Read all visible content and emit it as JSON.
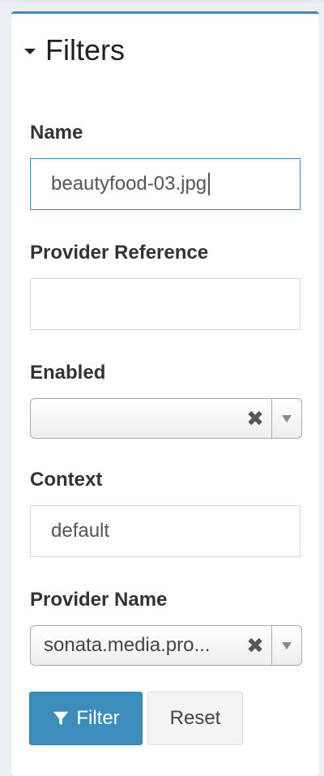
{
  "filters": {
    "title": "Filters",
    "fields": {
      "name": {
        "label": "Name",
        "value": "beautyfood-03.jpg"
      },
      "provider_reference": {
        "label": "Provider Reference",
        "value": ""
      },
      "enabled": {
        "label": "Enabled",
        "value": ""
      },
      "context": {
        "label": "Context",
        "value": "default"
      },
      "provider_name": {
        "label": "Provider Name",
        "value": "sonata.media.pro..."
      }
    },
    "buttons": {
      "filter": "Filter",
      "reset": "Reset"
    }
  },
  "colors": {
    "accent": "#3c8dbc",
    "border": "#d2d6de"
  },
  "icons": {
    "collapse": "caret-down-icon",
    "filter": "filter-funnel-icon",
    "clear": "close-icon",
    "dropdown": "chevron-down-icon"
  }
}
